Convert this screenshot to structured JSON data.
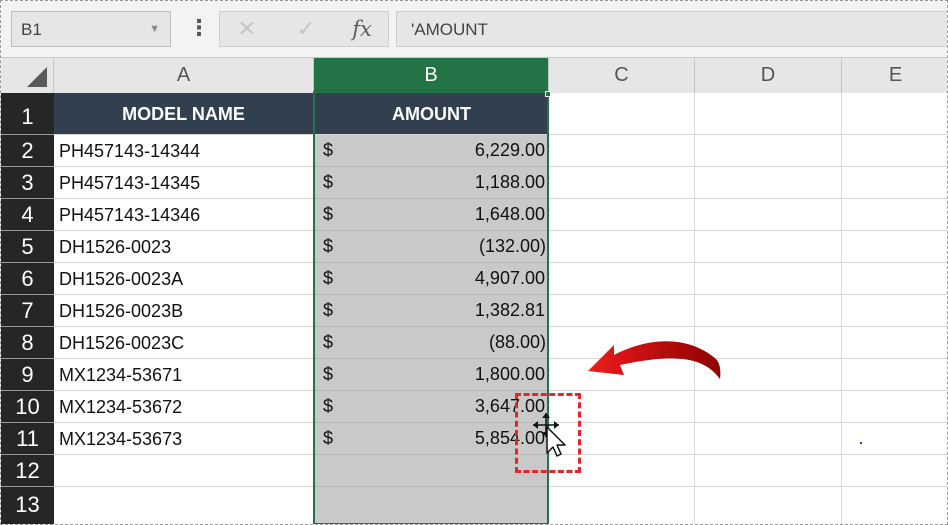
{
  "formula_bar": {
    "name_box": "B1",
    "fx_label": "fx",
    "formula": "'AMOUNT"
  },
  "columns": [
    "A",
    "B",
    "C",
    "D",
    "E"
  ],
  "selected_column": "B",
  "rows": [
    "1",
    "2",
    "3",
    "4",
    "5",
    "6",
    "7",
    "8",
    "9",
    "10",
    "11",
    "12",
    "13"
  ],
  "sheet": {
    "headers": {
      "a": "MODEL NAME",
      "b": "AMOUNT"
    },
    "data": [
      {
        "model": "PH457143-14344",
        "currency": "$",
        "amount": "6,229.00"
      },
      {
        "model": "PH457143-14345",
        "currency": "$",
        "amount": "1,188.00"
      },
      {
        "model": "PH457143-14346",
        "currency": "$",
        "amount": "1,648.00"
      },
      {
        "model": "DH1526-0023",
        "currency": "$",
        "amount": "(132.00)"
      },
      {
        "model": "DH1526-0023A",
        "currency": "$",
        "amount": "4,907.00"
      },
      {
        "model": "DH1526-0023B",
        "currency": "$",
        "amount": "1,382.81"
      },
      {
        "model": "DH1526-0023C",
        "currency": "$",
        "amount": "(88.00)"
      },
      {
        "model": "MX1234-53671",
        "currency": "$",
        "amount": "1,800.00"
      },
      {
        "model": "MX1234-53672",
        "currency": "$",
        "amount": "3,647.00"
      },
      {
        "model": "MX1234-53673",
        "currency": "$",
        "amount": "5,854.00"
      }
    ]
  },
  "colors": {
    "selection_green": "#227447",
    "header_fill": "#323f4f",
    "row_header_fill": "#262626",
    "highlight_red": "#e4262b",
    "arrow_red": "#c00000"
  },
  "icons": {
    "cancel": "close-icon",
    "enter": "check-icon",
    "insert_function": "fx-icon",
    "more": "vertical-dots-icon",
    "move_cursor": "move-cursor-icon",
    "pointer": "annotation-arrow-icon"
  }
}
